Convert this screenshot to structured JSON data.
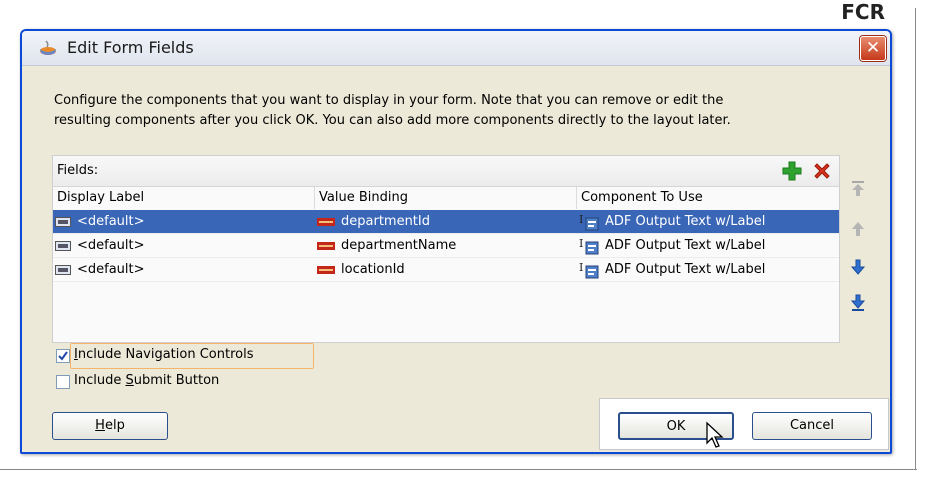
{
  "background": {
    "fragment": "FCR"
  },
  "dialog": {
    "title": "Edit Form Fields",
    "close_label": "✕",
    "description_line1": "Configure the components that you want to display in your form.  Note that you can remove or edit the",
    "description_line2": "resulting components after you click OK.  You can also add more components directly to the layout later."
  },
  "fields": {
    "label": "Fields:",
    "columns": [
      "Display Label",
      "Value Binding",
      "Component To Use"
    ],
    "rows": [
      {
        "display_label": "<default>",
        "value_binding": "departmentId",
        "component": "ADF Output Text w/Label",
        "selected": true
      },
      {
        "display_label": "<default>",
        "value_binding": "departmentName",
        "component": "ADF Output Text w/Label",
        "selected": false
      },
      {
        "display_label": "<default>",
        "value_binding": "locationId",
        "component": "ADF Output Text w/Label",
        "selected": false
      }
    ]
  },
  "options": {
    "include_nav_controls": {
      "label_u": "I",
      "label_rest": "nclude Navigation Controls",
      "checked": true
    },
    "include_submit_button": {
      "label_pre": "Include ",
      "label_u": "S",
      "label_rest": "ubmit Button",
      "checked": false
    }
  },
  "buttons": {
    "help_u": "H",
    "help_rest": "elp",
    "ok": "OK",
    "cancel": "Cancel"
  },
  "colors": {
    "selection": "#3966b6",
    "dialog_border": "#0a4ad6",
    "add_icon": "#2ea12e",
    "remove_icon": "#d8331e",
    "arrow_icon": "#2f6fd0"
  }
}
